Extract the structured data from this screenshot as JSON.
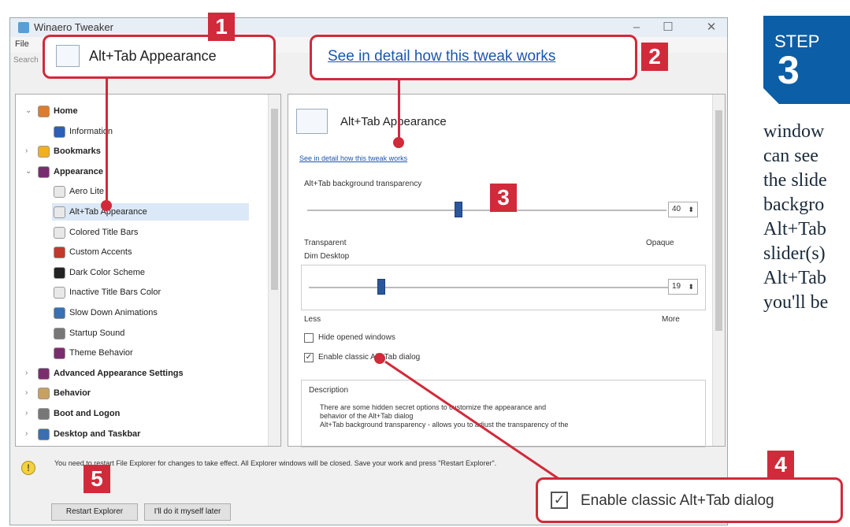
{
  "window": {
    "title": "Winaero Tweaker",
    "menu": [
      "File"
    ],
    "search_hint": "Search"
  },
  "tree": {
    "items": [
      {
        "label": "Home",
        "bold": true,
        "arrow": "v"
      },
      {
        "label": "Information"
      },
      {
        "label": "Bookmarks",
        "bold": true,
        "arrow": ">"
      },
      {
        "label": "Appearance",
        "bold": true,
        "arrow": "v"
      },
      {
        "label": "Aero Lite"
      },
      {
        "label": "Alt+Tab Appearance",
        "selected": true
      },
      {
        "label": "Colored Title Bars"
      },
      {
        "label": "Custom Accents"
      },
      {
        "label": "Dark Color Scheme"
      },
      {
        "label": "Inactive Title Bars Color"
      },
      {
        "label": "Slow Down Animations"
      },
      {
        "label": "Startup Sound"
      },
      {
        "label": "Theme Behavior"
      },
      {
        "label": "Advanced Appearance Settings",
        "bold": true,
        "arrow": ">"
      },
      {
        "label": "Behavior",
        "bold": true,
        "arrow": ">"
      },
      {
        "label": "Boot and Logon",
        "bold": true,
        "arrow": ">"
      },
      {
        "label": "Desktop and Taskbar",
        "bold": true,
        "arrow": ">"
      }
    ]
  },
  "detail": {
    "heading": "Alt+Tab Appearance",
    "link": "See in detail how this tweak works",
    "transparency_label": "Alt+Tab background transparency",
    "transparency_value": "40",
    "transparency_fraction": 0.41,
    "left_label": "Transparent",
    "right_label": "Opaque",
    "dim_label": "Dim Desktop",
    "dim_value": "19",
    "dim_fraction": 0.19,
    "dim_left": "Less",
    "dim_right": "More",
    "hide_windows": "Hide opened windows",
    "classic_dialog": "Enable classic Alt+Tab dialog",
    "description_title": "Description",
    "description_lines": [
      "There are some hidden secret options to customize the appearance and",
      "behavior of the Alt+Tab dialog",
      "Alt+Tab background transparency - allows you to adjust the transparency of the"
    ]
  },
  "bottom": {
    "notice": "You need to restart File Explorer for changes to take effect. All Explorer windows will be closed. Save your work and press \"Restart Explorer\".",
    "restart_button": "Restart Explorer",
    "later_button": "I'll do it myself later"
  },
  "callouts": {
    "c1_text": "Alt+Tab Appearance",
    "c2_text": "See in detail how this tweak works",
    "c4_text": "Enable classic Alt+Tab dialog",
    "n1": "1",
    "n2": "2",
    "n3": "3",
    "n4": "4",
    "n5": "5"
  },
  "step": {
    "label": "STEP",
    "number": "3"
  },
  "side_text": [
    "window",
    "can see",
    "the slide",
    "backgro",
    "Alt+Tab",
    "slider(s)",
    "Alt+Tab",
    "you'll be"
  ],
  "colors": {
    "accent_red": "#d12a3a",
    "step_blue": "#0c5ea6",
    "slider_blue": "#2b579a"
  }
}
